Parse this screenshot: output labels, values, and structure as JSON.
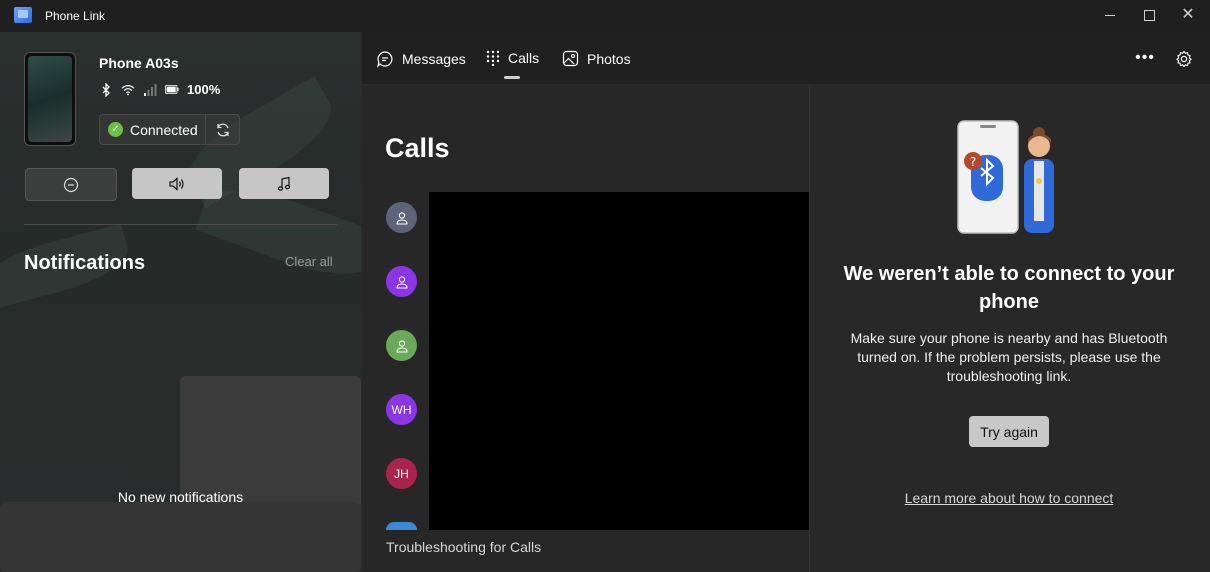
{
  "window": {
    "title": "Phone Link",
    "icon": "phone-link-app-icon"
  },
  "device": {
    "name": "Phone A03s",
    "battery": "100%",
    "connection_status": "Connected",
    "status_icons": [
      "bluetooth-icon",
      "wifi-icon",
      "signal-icon",
      "battery-icon"
    ]
  },
  "quick_actions": [
    {
      "name": "do-not-disturb",
      "icon": "minus-circle-icon"
    },
    {
      "name": "volume",
      "icon": "speaker-icon"
    },
    {
      "name": "media",
      "icon": "music-note-icon"
    }
  ],
  "notifications": {
    "title": "Notifications",
    "clear_all": "Clear all",
    "empty_text": "No new notifications"
  },
  "tabs": [
    {
      "label": "Messages",
      "icon": "chat-icon"
    },
    {
      "label": "Calls",
      "icon": "dialpad-icon",
      "active": true
    },
    {
      "label": "Photos",
      "icon": "photo-icon"
    }
  ],
  "calls": {
    "heading": "Calls",
    "contacts": [
      {
        "initials": "",
        "color": "#5b6478"
      },
      {
        "initials": "",
        "color": "#8a35e6"
      },
      {
        "initials": "",
        "color": "#6aa95a"
      },
      {
        "initials": "WH",
        "color": "#8a35e6"
      },
      {
        "initials": "JH",
        "color": "#a8234e"
      }
    ],
    "troubleshoot_link": "Troubleshooting for Calls"
  },
  "error_panel": {
    "title": "We weren’t able to connect to your phone",
    "body": "Make sure your phone is nearby and has Bluetooth turned on. If the problem persists, please use the troubleshooting link.",
    "retry_button": "Try again",
    "learn_more": "Learn more about how to connect"
  },
  "colors": {
    "app_bg": "#202020",
    "connected_green": "#6cc04a",
    "button_light": "#c6c6c6"
  }
}
